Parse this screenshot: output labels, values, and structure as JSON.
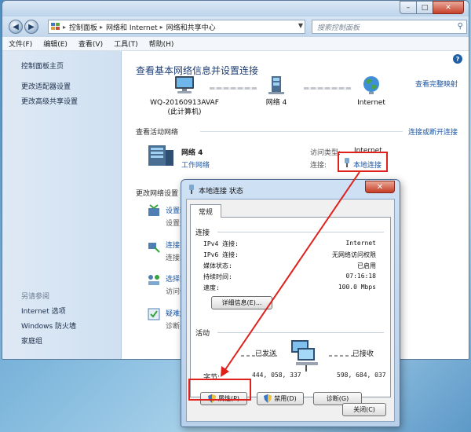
{
  "window": {
    "address": [
      "控制面板",
      "网络和 Internet",
      "网络和共享中心"
    ],
    "search_placeholder": "搜索控制面板"
  },
  "menubar": [
    "文件(F)",
    "编辑(E)",
    "查看(V)",
    "工具(T)",
    "帮助(H)"
  ],
  "sidebar": {
    "items": [
      "控制面板主页",
      "更改适配器设置",
      "更改高级共享设置"
    ],
    "see_also_heading": "另请参阅",
    "see_also": [
      "Internet 选项",
      "Windows 防火墙",
      "家庭组"
    ]
  },
  "content": {
    "title": "查看基本网络信息并设置连接",
    "full_map_link": "查看完整映射",
    "computer_name": "WQ-20160913AVAF",
    "computer_sub": "(此计算机)",
    "network_node": "网络  4",
    "internet_node": "Internet",
    "active_networks_label": "查看活动网络",
    "connect_disconnect_link": "连接或断开连接",
    "network_name": "网络  4",
    "network_type": "工作网络",
    "access_type_label": "访问类型:",
    "access_type_value": "Internet",
    "connections_label": "连接:",
    "connection_link": "本地连接",
    "change_settings_label": "更改网络设置",
    "settings": [
      {
        "title": "设置新",
        "desc": "设置无"
      },
      {
        "title": "连接到",
        "desc": "连接或"
      },
      {
        "title": "选择家",
        "desc": "访问位"
      },
      {
        "title": "疑难解",
        "desc": "诊断并"
      }
    ]
  },
  "dialog": {
    "title": "本地连接 状态",
    "close_symbol": "✕",
    "tab": "常规",
    "connection_group": "连接",
    "rows": [
      {
        "label": "IPv4 连接:",
        "value": "Internet"
      },
      {
        "label": "IPv6 连接:",
        "value": "无网络访问权限"
      },
      {
        "label": "媒体状态:",
        "value": "已启用"
      },
      {
        "label": "持续时间:",
        "value": "07:16:18"
      },
      {
        "label": "速度:",
        "value": "100.0 Mbps"
      }
    ],
    "details_button": "详细信息(E)...",
    "activity_group": "活动",
    "sent_label": "已发送",
    "received_label": "已接收",
    "bytes_label": "字节:",
    "bytes_sent": "444, 058, 337",
    "bytes_received": "598, 684, 037",
    "properties_button": "属性(P)",
    "disable_button": "禁用(D)",
    "diagnose_button": "诊断(G)",
    "close_button": "关闭(C)"
  },
  "colors": {
    "link": "#1b56a5",
    "title": "#1e3f75",
    "annotation_red": "#e0211b"
  }
}
